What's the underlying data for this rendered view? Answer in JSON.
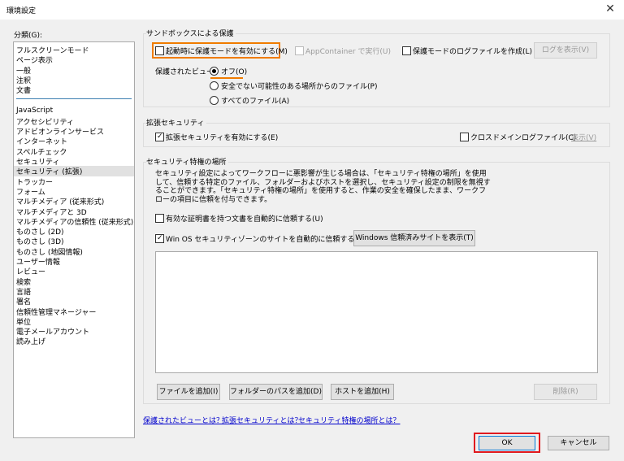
{
  "window": {
    "title": "環境設定",
    "close_glyph": "✕"
  },
  "categories": {
    "label": "分類(G):",
    "group1": [
      "フルスクリーンモード",
      "ページ表示",
      "一般",
      "注釈",
      "文書"
    ],
    "group2": [
      "JavaScript",
      "アクセシビリティ",
      "アドビオンラインサービス",
      "インターネット",
      "スペルチェック",
      "セキュリティ",
      "セキュリティ (拡張)",
      "トラッカー",
      "フォーム",
      "マルチメディア (従来形式)",
      "マルチメディアと 3D",
      "マルチメディアの信頼性 (従来形式)",
      "ものさし (2D)",
      "ものさし (3D)",
      "ものさし (地図情報)",
      "ユーザー情報",
      "レビュー",
      "検索",
      "言語",
      "署名",
      "信頼性管理マネージャー",
      "単位",
      "電子メールアカウント",
      "読み上げ"
    ],
    "selected": "セキュリティ (拡張)"
  },
  "sandbox": {
    "title": "サンドボックスによる保護",
    "enable_protected_mode": "起動時に保護モードを有効にする(M)",
    "app_container": "AppContainer で実行(U)",
    "create_log": "保護モードのログファイルを作成(L)",
    "view_log": "ログを表示(V)",
    "protected_view_label": "保護されたビュー：",
    "radio_off": "オフ(O)",
    "radio_unsafe": "安全でない可能性のある場所からのファイル(P)",
    "radio_all": "すべてのファイル(A)"
  },
  "enhanced": {
    "title": "拡張セキュリティ",
    "enable": "拡張セキュリティを有効にする(E)",
    "cross_domain": "クロスドメインログファイル(C)",
    "view": "表示(V)"
  },
  "privileged": {
    "title": "セキュリティ特権の場所",
    "description": [
      "セキュリティ設定によってワークフローに悪影響が生じる場合は、「セキュリティ特権の場所」を使用",
      "して、信頼する特定のファイル、フォルダーおよびホストを選択し、セキュリティ設定の制限を無視す",
      "ることができます。「セキュリティ特権の場所」を使用すると、作業の安全を確保したまま、ワークフ",
      "ローの項目に信頼を付与できます。"
    ],
    "trust_certified": "有効な証明書を持つ文書を自動的に信頼する(U)",
    "trust_win_os": "Win OS セキュリティゾーンのサイトを自動的に信頼する(S)",
    "show_windows_sites": "Windows 信頼済みサイトを表示(T)",
    "add_file": "ファイルを追加(I)",
    "add_folder": "フォルダーのパスを追加(D)",
    "add_host": "ホストを追加(H)",
    "delete": "削除(R)"
  },
  "links": {
    "protected_view": "保護されたビューとは？",
    "enhanced_security": "拡張セキュリティとは？",
    "privileged_location": "セキュリティ特権の場所とは？"
  },
  "footer": {
    "ok": "OK",
    "cancel": "キャンセル"
  },
  "highlight_colors": {
    "orange": "#f07c00",
    "red": "#e0191f"
  }
}
